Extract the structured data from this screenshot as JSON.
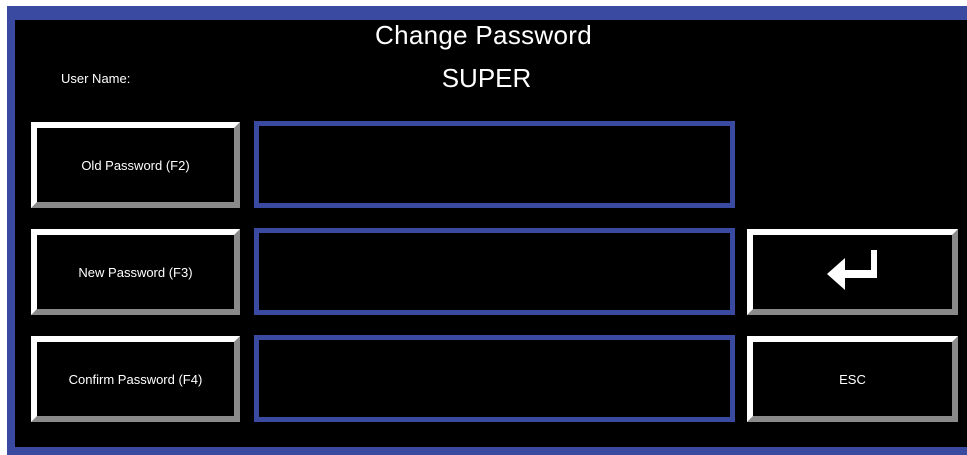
{
  "dialog": {
    "title": "Change Password",
    "user_label": "User Name:",
    "user_value": "SUPER"
  },
  "fields": {
    "old_password": {
      "button_label": "Old Password (F2)",
      "value": ""
    },
    "new_password": {
      "button_label": "New Password (F3)",
      "value": ""
    },
    "confirm_password": {
      "button_label": "Confirm Password (F4)",
      "value": ""
    }
  },
  "actions": {
    "enter_icon": "enter-return-arrow-icon",
    "esc_label": "ESC"
  },
  "colors": {
    "background": "#000000",
    "frame_border": "#3a4aa0",
    "text": "#ffffff"
  }
}
